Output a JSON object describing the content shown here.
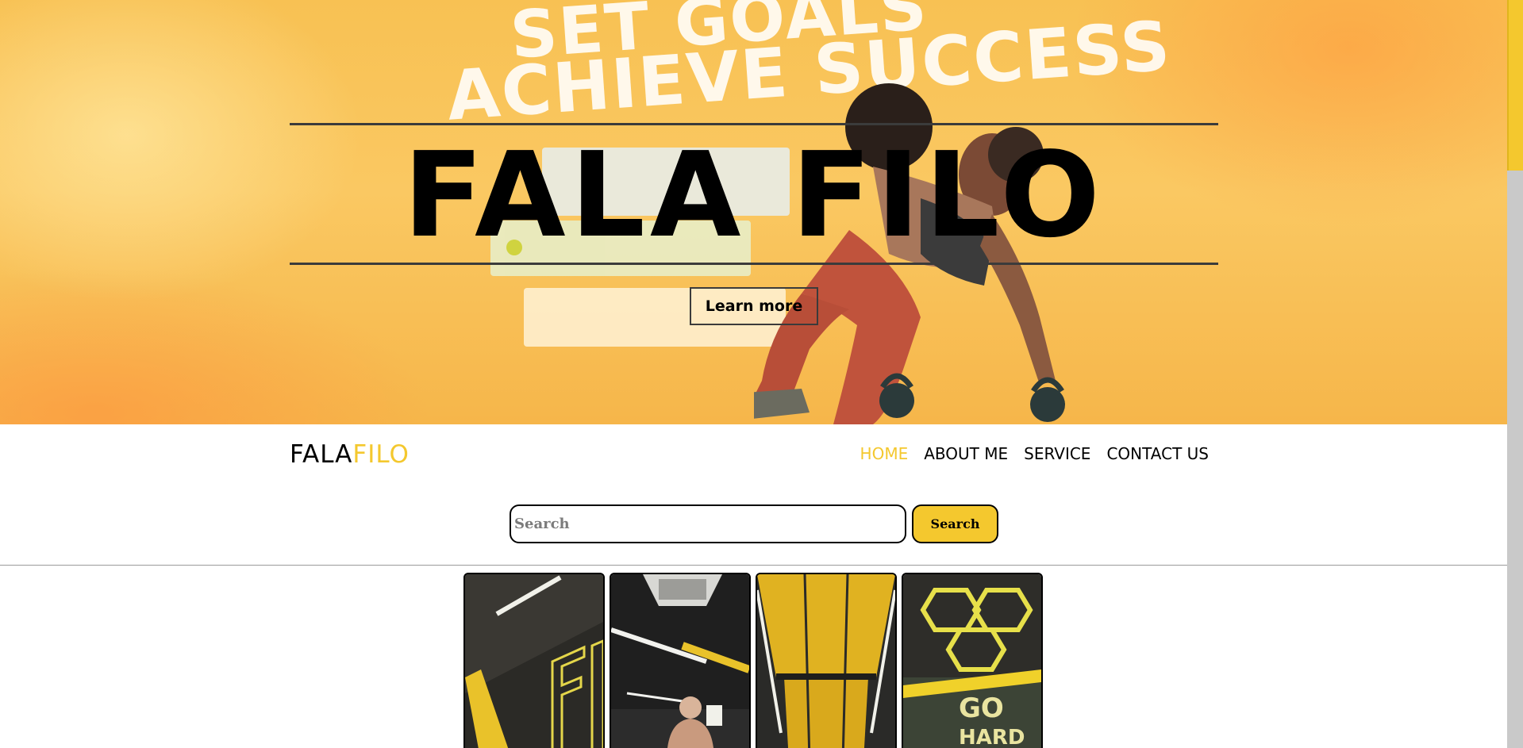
{
  "hero": {
    "background_text": [
      "SET GOALS",
      "ACHIEVE SUCCESS"
    ],
    "title": "FALA FILO",
    "cta_label": "Learn more"
  },
  "brand": {
    "part1": "FALA",
    "part2": "FILO",
    "accent_color": "#f4c82e"
  },
  "nav": {
    "items": [
      {
        "label": "HOME",
        "active": true
      },
      {
        "label": "ABOUT ME",
        "active": false
      },
      {
        "label": "SERVICE",
        "active": false
      },
      {
        "label": "CONTACT US",
        "active": false
      }
    ]
  },
  "search": {
    "placeholder": "Search",
    "value": "",
    "button_label": "Search"
  },
  "gallery": {
    "items": [
      {
        "icon": "gym-wall-image"
      },
      {
        "icon": "gym-interior-image"
      },
      {
        "icon": "gym-corridor-image"
      },
      {
        "icon": "gym-ceiling-image",
        "sign_text": [
          "GO",
          "HARD"
        ]
      }
    ]
  }
}
